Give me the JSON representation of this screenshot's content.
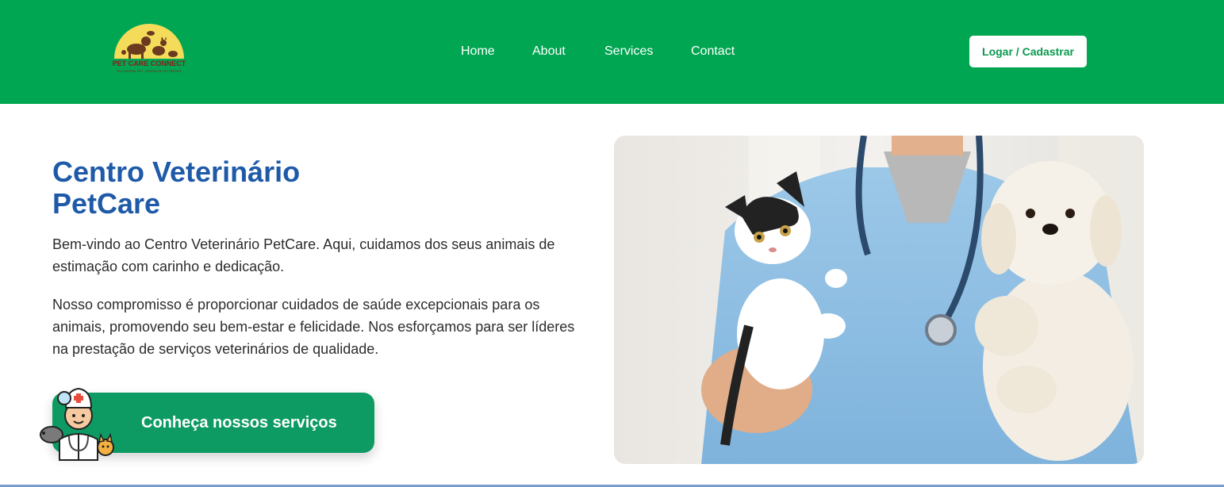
{
  "header": {
    "logo": {
      "brand_text": "PET CARE CONNECT",
      "tagline": "SEU CENTRAL PET - CENTRO DE PET SERVICE",
      "icon": "pet-silhouettes-icon"
    },
    "nav": [
      {
        "label": "Home"
      },
      {
        "label": "About"
      },
      {
        "label": "Services"
      },
      {
        "label": "Contact"
      }
    ],
    "login_label": "Logar / Cadastrar"
  },
  "main": {
    "title_line1": "Centro Veterinário",
    "title_line2": "PetCare",
    "paragraph1": "Bem-vindo ao Centro Veterinário PetCare. Aqui, cuidamos dos seus animais de estimação com carinho e dedicação.",
    "paragraph2": "Nosso compromisso é proporcionar cuidados de saúde excepcionais para os animais, promovendo seu bem-estar e felicidade. Nos esforçamos para ser líderes na prestação de serviços veterinários de qualidade.",
    "cta_label": "Conheça nossos serviços",
    "cta_icon": "veterinarian-doctor-icon",
    "hero_image": "veterinarian-holding-cat-and-dog-photo"
  },
  "colors": {
    "header_bg": "#00a651",
    "title": "#1e5aa8",
    "cta_bg": "#0d9b63",
    "login_text": "#0a9a4e"
  }
}
